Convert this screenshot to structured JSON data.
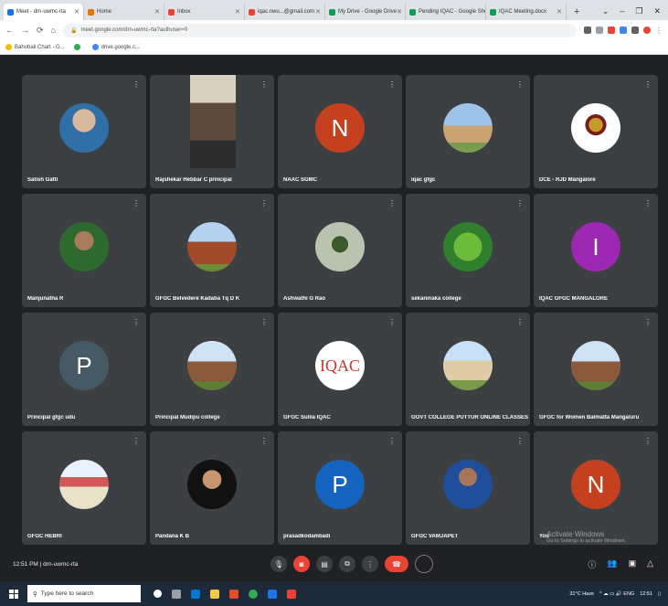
{
  "browser": {
    "tabs": [
      {
        "label": "Meet - drn-uwmc-rta",
        "color": "#1a73e8",
        "active": true
      },
      {
        "label": "Home",
        "color": "#e37400",
        "active": false
      },
      {
        "label": "Inbox",
        "color": "#ea4335",
        "active": false
      },
      {
        "label": "iqac.nwu...@gmail.com",
        "color": "#ea4335",
        "active": false
      },
      {
        "label": "My Drive - Google Drive",
        "color": "#0f9d58",
        "active": false
      },
      {
        "label": "Pending IQAC - Google Shee",
        "color": "#0f9d58",
        "active": false
      },
      {
        "label": "IQAC Meeting.docx",
        "color": "#0f9d58",
        "active": false
      }
    ],
    "new_tab": "+",
    "window_controls": [
      "⌄",
      "–",
      "❐",
      "✕"
    ],
    "url": "meet.google.com/drn-uwmc-rta?authuser=0",
    "bookmarks": [
      {
        "label": "Bahubali Chart - G...",
        "color": "#fbbc04"
      },
      {
        "label": "",
        "color": "#34a853"
      },
      {
        "label": "drive.google.c...",
        "color": "#4285f4"
      }
    ]
  },
  "participants": [
    {
      "name": "Satish Gatti",
      "avatar": "photo"
    },
    {
      "name": "Rajshekar Hebbar C principal",
      "avatar": "video"
    },
    {
      "name": "NAAC SGMC",
      "avatar": "letter",
      "letter": "N",
      "color": "#c5401f"
    },
    {
      "name": "iqac gfgc",
      "avatar": "building"
    },
    {
      "name": "DCE - RJD Mangalore",
      "avatar": "emblem"
    },
    {
      "name": "Manjunatha R",
      "avatar": "man"
    },
    {
      "name": "GFGC Belvedere Kadaba Tq D K",
      "avatar": "college"
    },
    {
      "name": "Ashwathi G Rao",
      "avatar": "tree"
    },
    {
      "name": "sekaninaka college",
      "avatar": "green"
    },
    {
      "name": "IQAC GFGC MANGALORE",
      "avatar": "letter",
      "letter": "I",
      "color": "#9c27b0"
    },
    {
      "name": "Principal gfgc udu",
      "avatar": "letter",
      "letter": "P",
      "color": "#455a64"
    },
    {
      "name": "Principal Mudipu college",
      "avatar": "old"
    },
    {
      "name": "GFGC Sullia IQAC",
      "avatar": "iqac",
      "letter": "IQAC"
    },
    {
      "name": "GOVT COLLEGE PUTTUR ONLINE CLASSES Puttur",
      "avatar": "govt"
    },
    {
      "name": "GFGC for Women Balmatta Mangaluru",
      "avatar": "old"
    },
    {
      "name": "GFGC HEBRI",
      "avatar": "dk"
    },
    {
      "name": "Pandana K B",
      "avatar": "woman"
    },
    {
      "name": "prasadkodambadi",
      "avatar": "letter",
      "letter": "P",
      "color": "#1565c0"
    },
    {
      "name": "GFGC VAMJAPET",
      "avatar": "suit"
    },
    {
      "name": "You",
      "avatar": "letter",
      "letter": "N",
      "color": "#c5401f"
    }
  ],
  "controls": {
    "time_code": "12:51 PM | drn-uwmc-rta",
    "buttons": [
      "mic-button",
      "camera-off-button",
      "captions-button",
      "present-button",
      "more-button",
      "end-call-button"
    ],
    "activate_title": "Activate Windows",
    "activate_sub": "Go to Settings to activate Windows."
  },
  "taskbar": {
    "search_placeholder": "Type here to search",
    "tray_text": "31°C  Haze",
    "clock": "12:51"
  }
}
